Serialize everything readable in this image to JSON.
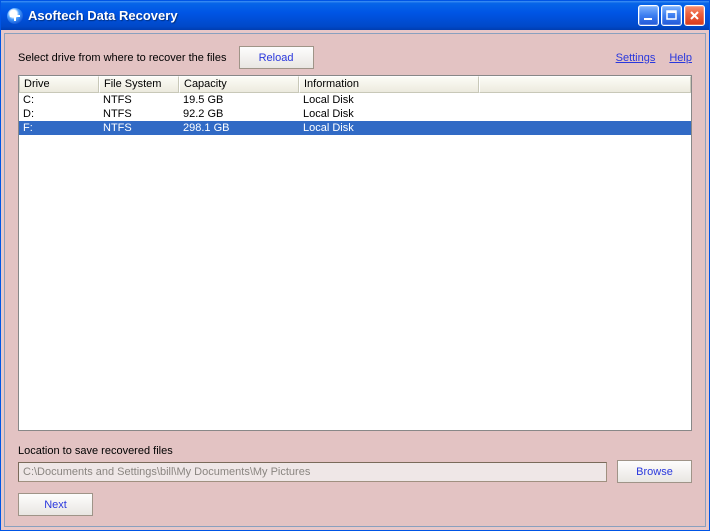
{
  "window": {
    "title": "Asoftech Data Recovery"
  },
  "top": {
    "prompt": "Select drive from where to recover the files",
    "reload_label": "Reload",
    "settings_label": "Settings",
    "help_label": "Help"
  },
  "list": {
    "columns": [
      "Drive",
      "File System",
      "Capacity",
      "Information",
      ""
    ],
    "rows": [
      {
        "drive": "C:",
        "fs": "NTFS",
        "capacity": "19.5 GB",
        "info": "Local Disk",
        "selected": false
      },
      {
        "drive": "D:",
        "fs": "NTFS",
        "capacity": "92.2 GB",
        "info": "Local Disk",
        "selected": false
      },
      {
        "drive": "F:",
        "fs": "NTFS",
        "capacity": "298.1 GB",
        "info": "Local Disk",
        "selected": true
      }
    ]
  },
  "location": {
    "label": "Location to save recovered files",
    "value": "C:\\Documents and Settings\\bill\\My Documents\\My Pictures",
    "browse_label": "Browse"
  },
  "footer": {
    "next_label": "Next"
  }
}
